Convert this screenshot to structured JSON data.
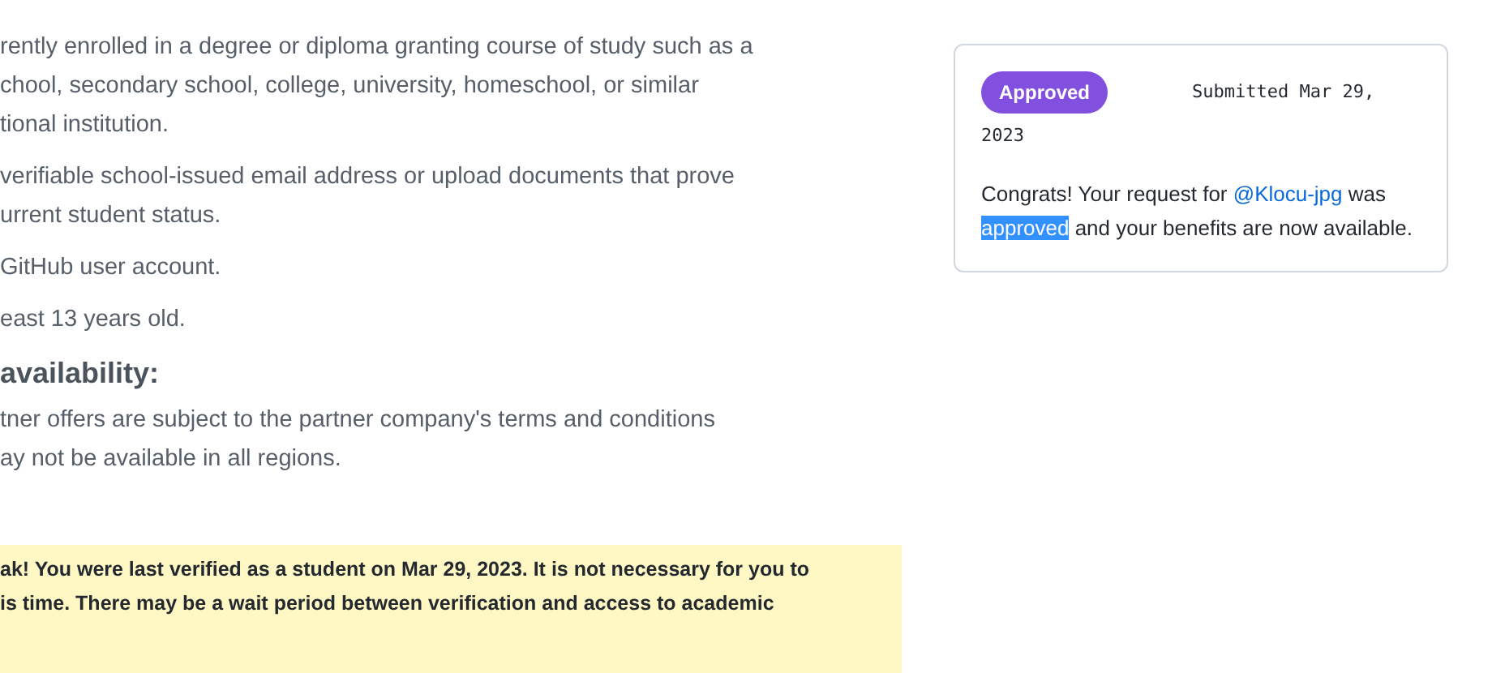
{
  "requirements": {
    "items": [
      {
        "lines": [
          "rently enrolled in a degree or diploma granting course of study such as a",
          "chool, secondary school, college, university, homeschool, or similar",
          "tional institution."
        ]
      },
      {
        "lines": [
          "verifiable school-issued email address or upload documents that prove",
          "urrent student status."
        ]
      },
      {
        "lines": [
          "GitHub user account."
        ]
      },
      {
        "lines": [
          "east 13 years old."
        ]
      }
    ]
  },
  "availability": {
    "heading": "availability:",
    "lines": [
      "tner offers are subject to the partner company's terms and conditions",
      "ay not be available in all regions."
    ]
  },
  "banner": {
    "lines": [
      "ak! You were last verified as a student on Mar 29, 2023. It is not necessary for you to",
      "is time. There may be a wait period between verification and access to academic"
    ]
  },
  "request": {
    "status": "Approved",
    "submitted": "Submitted Mar 29,",
    "submitted_year": "2023",
    "message": [
      {
        "kind": "text",
        "text": "Congrats! Your request for "
      },
      {
        "kind": "link",
        "text": "@Klocu-jpg"
      },
      {
        "kind": "text",
        "text": " was "
      },
      {
        "kind": "selected",
        "text": "approved"
      },
      {
        "kind": "text",
        "text": " and your benefits are now available."
      }
    ]
  }
}
